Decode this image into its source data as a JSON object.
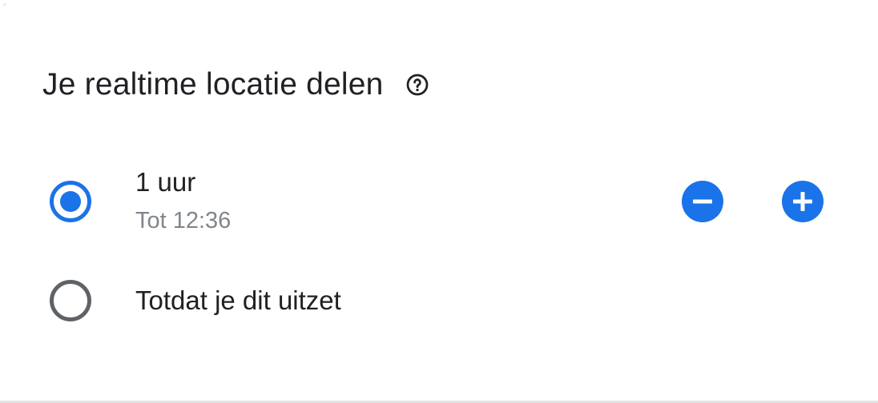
{
  "dialog": {
    "title": "Je realtime locatie delen",
    "help_icon": "help-circle-icon"
  },
  "options": [
    {
      "label": "1 uur",
      "sublabel": "Tot 12:36",
      "selected": true
    },
    {
      "label": "Totdat je dit uitzet",
      "selected": false
    }
  ],
  "stepper": {
    "decrease_icon": "minus-circle-icon",
    "increase_icon": "plus-circle-icon"
  },
  "colors": {
    "accent": "#1a73e8",
    "text_primary": "#202124",
    "text_secondary": "#80868b",
    "radio_unselected": "#5f6368"
  }
}
